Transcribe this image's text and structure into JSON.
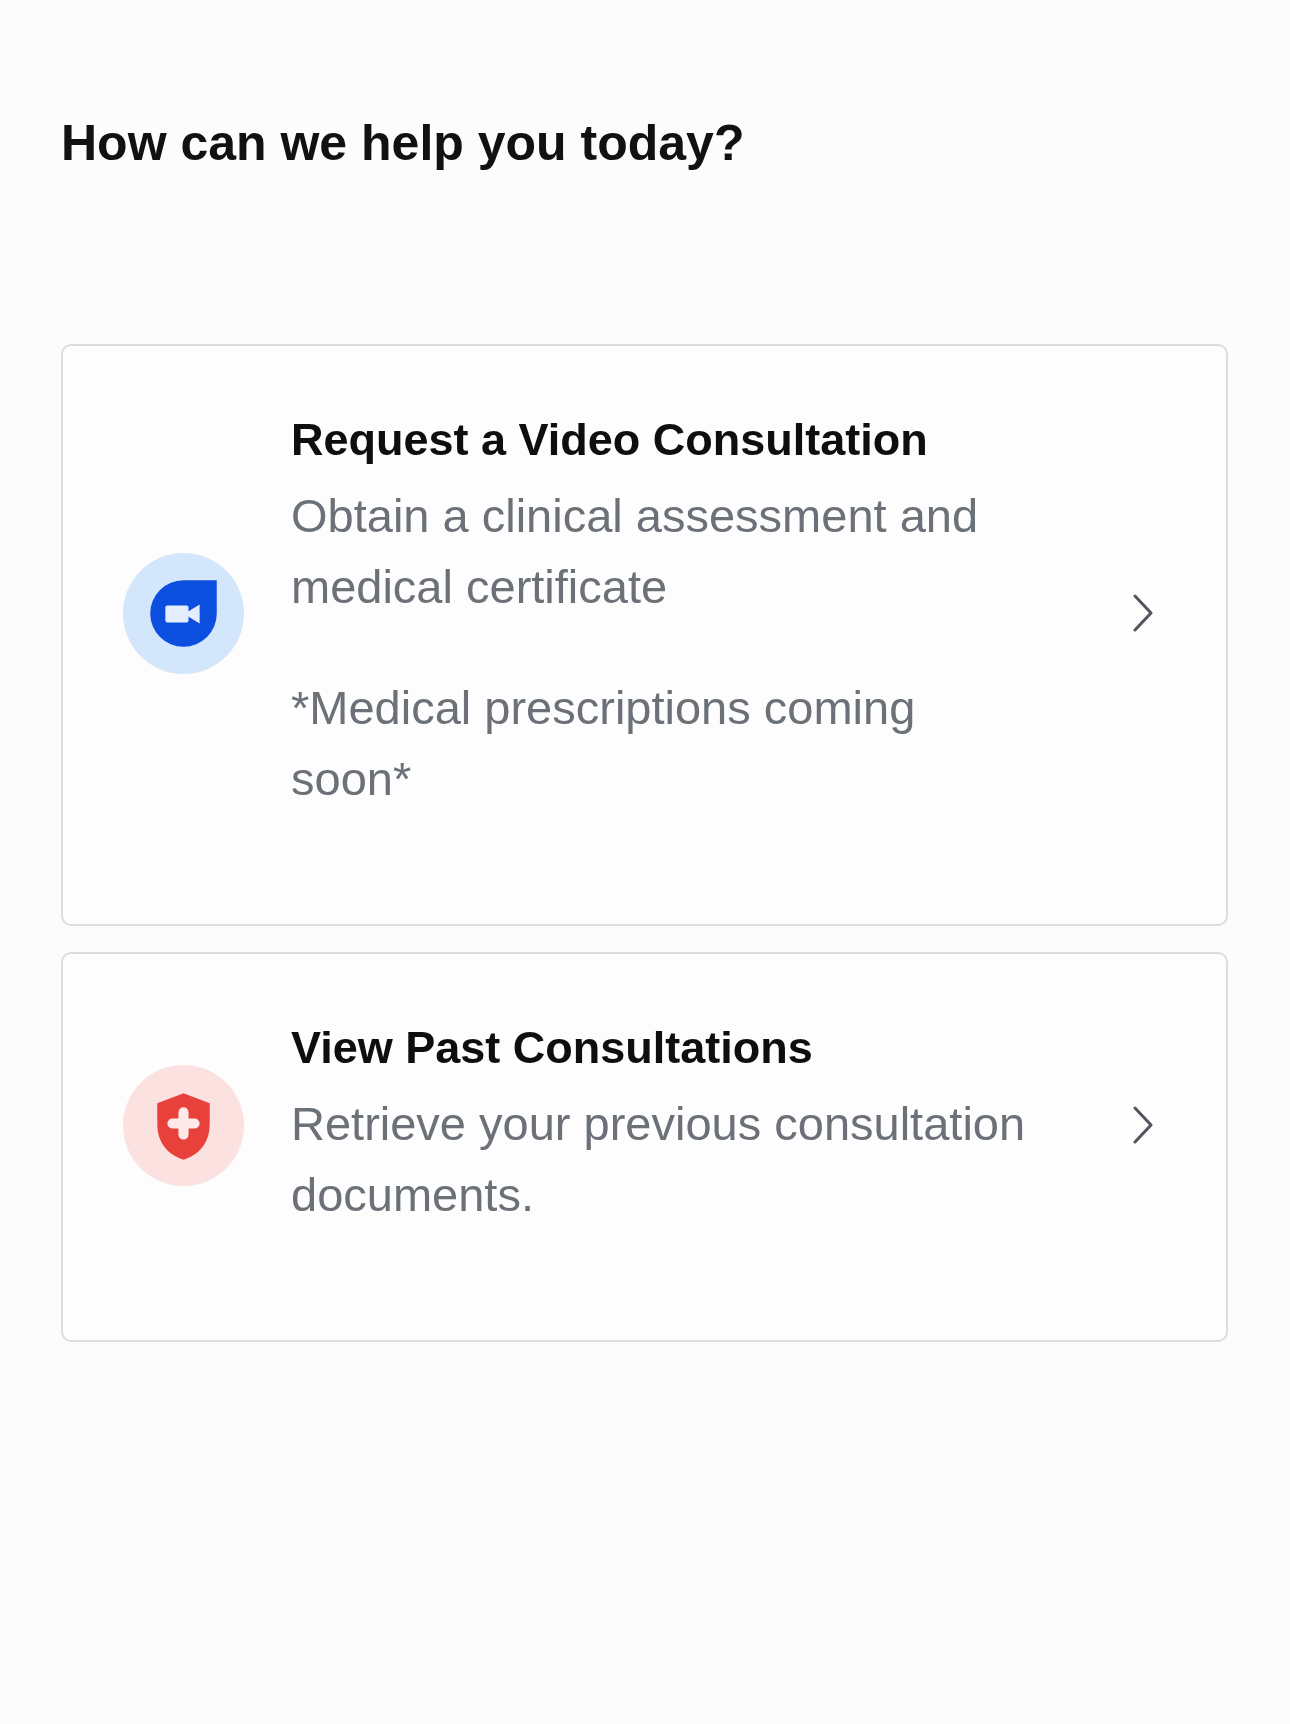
{
  "heading": "How can we help you today?",
  "options": [
    {
      "kind": "request",
      "title": "Request a Video Consultation",
      "description": "Obtain a clinical assessment and medical certificate",
      "note": "*Medical prescriptions coming soon*"
    },
    {
      "kind": "history",
      "title": "View Past Consultations",
      "description": "Retrieve your previous consultation documents."
    }
  ]
}
